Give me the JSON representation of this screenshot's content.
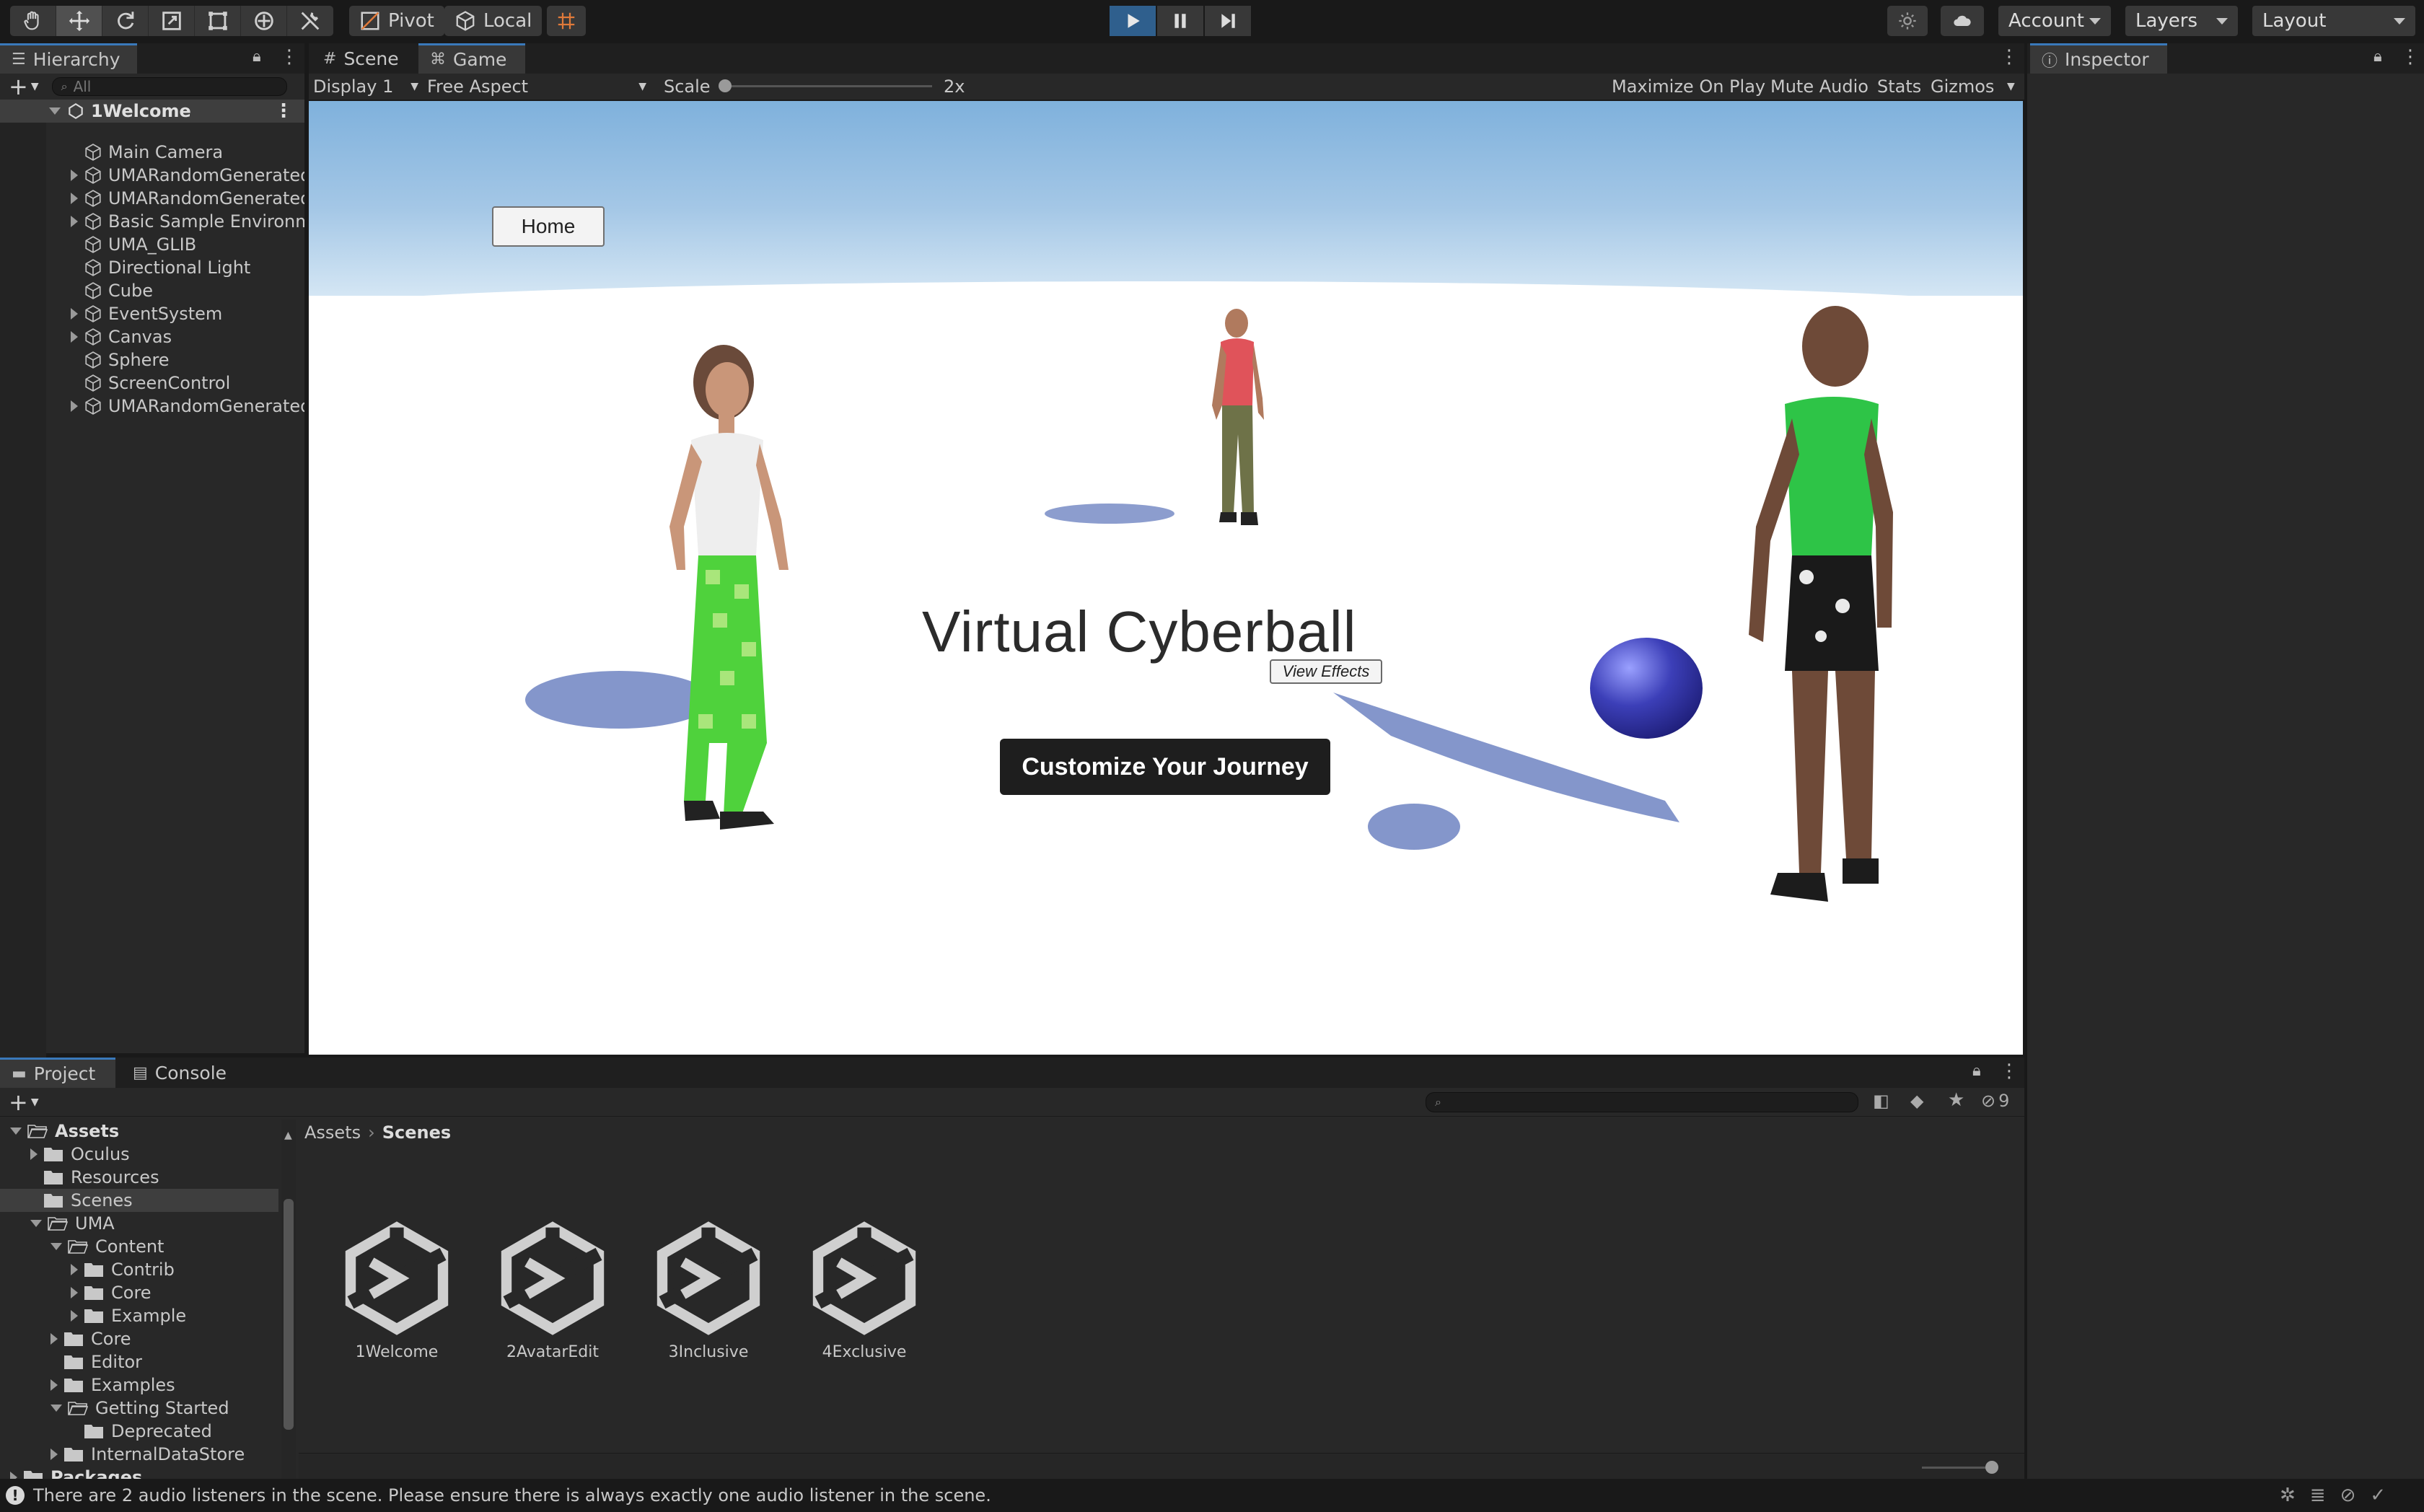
{
  "toolbar": {
    "pivot_label": "Pivot",
    "local_label": "Local",
    "account_label": "Account",
    "layers_label": "Layers",
    "layout_label": "Layout"
  },
  "hierarchy": {
    "tab_label": "Hierarchy",
    "search_placeholder": "All",
    "scene_name": "1Welcome",
    "items": [
      {
        "label": "Main Camera",
        "expandable": false
      },
      {
        "label": "UMARandomGenerated",
        "expandable": true
      },
      {
        "label": "UMARandomGenerated",
        "expandable": true
      },
      {
        "label": "Basic Sample Environm",
        "expandable": true
      },
      {
        "label": "UMA_GLIB",
        "expandable": false
      },
      {
        "label": "Directional Light",
        "expandable": false
      },
      {
        "label": "Cube",
        "expandable": false
      },
      {
        "label": "EventSystem",
        "expandable": true
      },
      {
        "label": "Canvas",
        "expandable": true
      },
      {
        "label": "Sphere",
        "expandable": false
      },
      {
        "label": "ScreenControl",
        "expandable": false
      },
      {
        "label": "UMARandomGenerated",
        "expandable": true
      }
    ]
  },
  "game_view": {
    "tabs": {
      "scene": "Scene",
      "game": "Game"
    },
    "display": "Display 1",
    "aspect": "Free Aspect",
    "scale_label": "Scale",
    "scale_value": "2x",
    "maximize": "Maximize On Play",
    "mute": "Mute Audio",
    "stats": "Stats",
    "gizmos": "Gizmos",
    "home_button": "Home",
    "title": "Virtual Cyberball",
    "view_effects": "View Effects",
    "customize_button": "Customize Your Journey"
  },
  "inspector": {
    "tab_label": "Inspector"
  },
  "project": {
    "tabs": {
      "project": "Project",
      "console": "Console"
    },
    "hidden_count": "9",
    "breadcrumb": {
      "root": "Assets",
      "current": "Scenes"
    },
    "tree": [
      {
        "label": "Assets",
        "level": 0,
        "arrow": "down",
        "bold": true
      },
      {
        "label": "Oculus",
        "level": 1,
        "arrow": "right"
      },
      {
        "label": "Resources",
        "level": 1,
        "arrow": "none"
      },
      {
        "label": "Scenes",
        "level": 1,
        "arrow": "none",
        "selected": true
      },
      {
        "label": "UMA",
        "level": 1,
        "arrow": "down"
      },
      {
        "label": "Content",
        "level": 2,
        "arrow": "down"
      },
      {
        "label": "Contrib",
        "level": 3,
        "arrow": "right"
      },
      {
        "label": "Core",
        "level": 3,
        "arrow": "right"
      },
      {
        "label": "Example",
        "level": 3,
        "arrow": "right"
      },
      {
        "label": "Core",
        "level": 2,
        "arrow": "right"
      },
      {
        "label": "Editor",
        "level": 2,
        "arrow": "none"
      },
      {
        "label": "Examples",
        "level": 2,
        "arrow": "right"
      },
      {
        "label": "Getting Started",
        "level": 2,
        "arrow": "down"
      },
      {
        "label": "Deprecated",
        "level": 3,
        "arrow": "none"
      },
      {
        "label": "InternalDataStore",
        "level": 2,
        "arrow": "right"
      },
      {
        "label": "Packages",
        "level": 0,
        "arrow": "right",
        "bold": true
      }
    ],
    "assets": [
      "1Welcome",
      "2AvatarEdit",
      "3Inclusive",
      "4Exclusive"
    ]
  },
  "status": {
    "message": "There are 2 audio listeners in the scene. Please ensure there is always exactly one audio listener in the scene."
  },
  "colors": {
    "accent": "#3a79bb",
    "play_active": "#2f5f8d",
    "panel": "#282828",
    "toolbar": "#191919"
  }
}
